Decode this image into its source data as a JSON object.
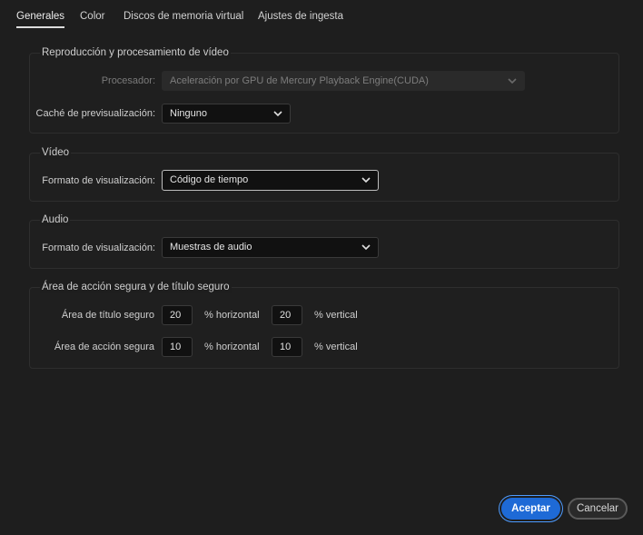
{
  "tabs": [
    {
      "label": "Generales",
      "active": true
    },
    {
      "label": "Color",
      "active": false
    },
    {
      "label": "Discos de memoria virtual",
      "active": false
    },
    {
      "label": "Ajustes de ingesta",
      "active": false
    }
  ],
  "playback": {
    "title": "Reproducción y procesamiento de vídeo",
    "processor_label": "Procesador:",
    "processor_value": "Aceleración por GPU de Mercury Playback Engine(CUDA)",
    "cache_label": "Caché de previsualización:",
    "cache_value": "Ninguno"
  },
  "video": {
    "title": "Vídeo",
    "format_label": "Formato de visualización:",
    "format_value": "Código de tiempo"
  },
  "audio": {
    "title": "Audio",
    "format_label": "Formato de visualización:",
    "format_value": "Muestras de audio"
  },
  "safe": {
    "title": "Área de acción segura y de título seguro",
    "title_safe_label": "Área de título seguro",
    "title_safe_h": "20",
    "title_safe_v": "20",
    "action_safe_label": "Área de acción segura",
    "action_safe_h": "10",
    "action_safe_v": "10",
    "horizontal_unit": "% horizontal",
    "vertical_unit": "% vertical"
  },
  "buttons": {
    "ok": "Aceptar",
    "cancel": "Cancelar"
  },
  "colors": {
    "accent": "#1e6ad6",
    "focus_ring": "#4d9bff",
    "background": "#1e1e1e"
  }
}
